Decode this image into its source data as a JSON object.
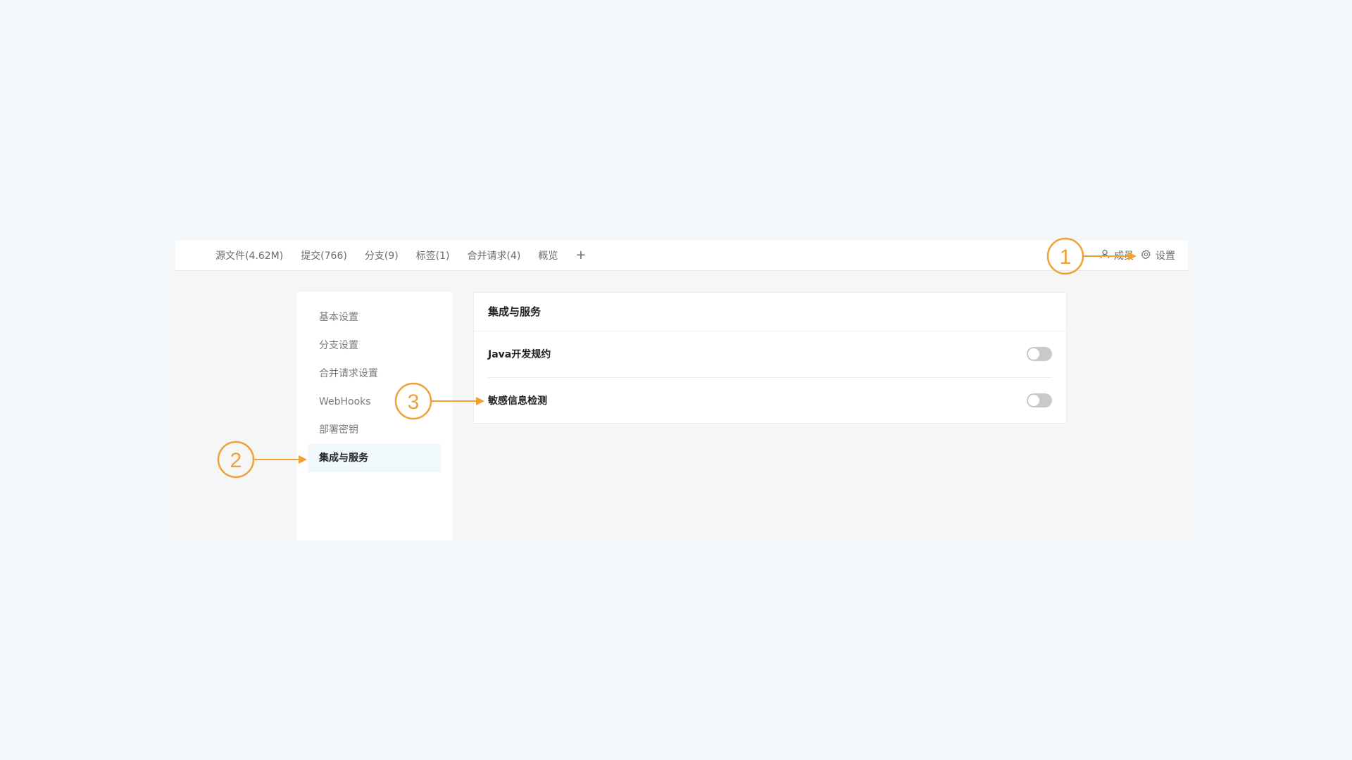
{
  "tabs": [
    "源文件(4.62M)",
    "提交(766)",
    "分支(9)",
    "标签(1)",
    "合并请求(4)",
    "概览"
  ],
  "add_tab_label": "+",
  "top_right": {
    "members_label": "成员",
    "settings_label": "设置"
  },
  "sidebar": {
    "items": [
      {
        "label": "基本设置"
      },
      {
        "label": "分支设置"
      },
      {
        "label": "合并请求设置"
      },
      {
        "label": "WebHooks"
      },
      {
        "label": "部署密钥"
      },
      {
        "label": "集成与服务",
        "active": true
      }
    ]
  },
  "panel": {
    "title": "集成与服务",
    "rows": [
      {
        "label": "Java开发规约",
        "enabled": false
      },
      {
        "label": "敏感信息检测",
        "enabled": false
      }
    ]
  },
  "annotations": [
    "1",
    "2",
    "3"
  ],
  "colors": {
    "accent": "#f0a035",
    "active_bg": "#f1f8fc"
  }
}
